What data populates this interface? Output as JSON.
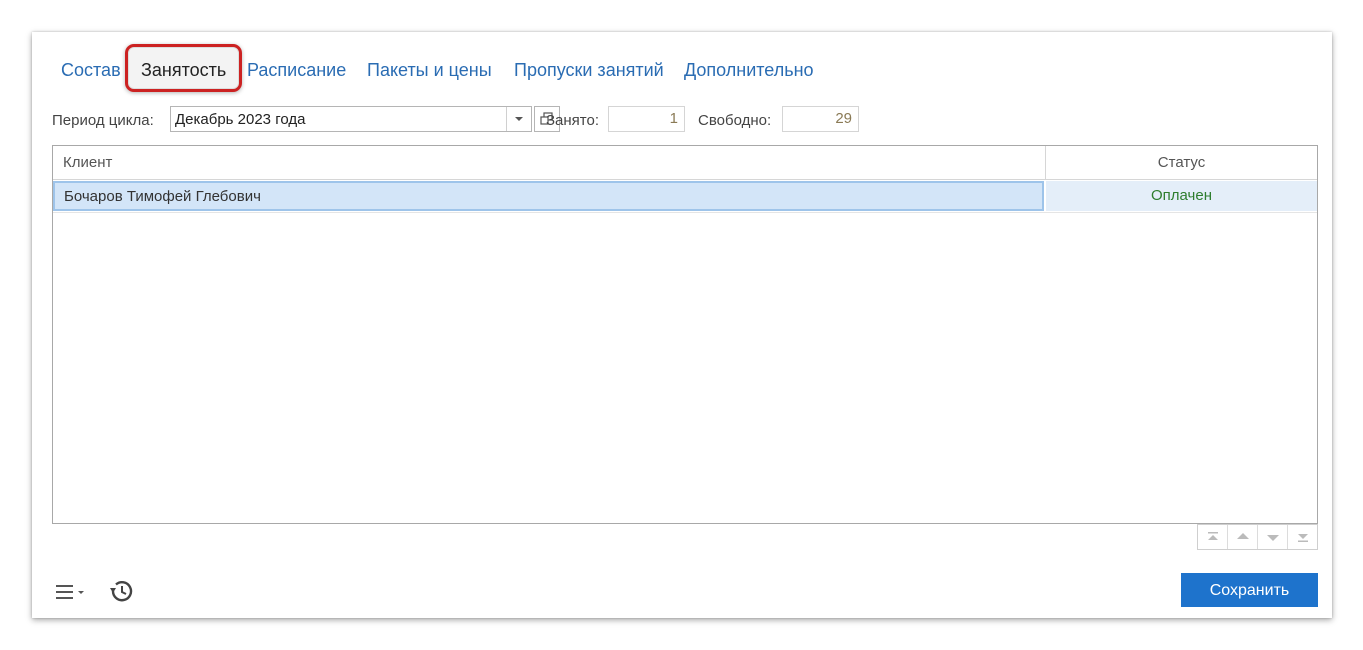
{
  "tabs": [
    {
      "label": "Состав",
      "active": false
    },
    {
      "label": "Занятость",
      "active": true
    },
    {
      "label": "Расписание",
      "active": false
    },
    {
      "label": "Пакеты и цены",
      "active": false
    },
    {
      "label": "Пропуски занятий",
      "active": false
    },
    {
      "label": "Дополнительно",
      "active": false
    }
  ],
  "period": {
    "label": "Период цикла:",
    "value": "Декабрь 2023 года"
  },
  "occupied": {
    "label": "Занято:",
    "value": "1"
  },
  "free": {
    "label": "Свободно:",
    "value": "29"
  },
  "table": {
    "columns": [
      "Клиент",
      "Статус"
    ],
    "rows": [
      {
        "client": "Бочаров Тимофей Глебович",
        "status": "Оплачен"
      }
    ]
  },
  "footer": {
    "save_label": "Сохранить"
  },
  "colors": {
    "accent": "#1e73cc",
    "tab_link": "#2a6cb3",
    "status_paid": "#2e7d2e",
    "highlight_border": "#cc2222"
  }
}
